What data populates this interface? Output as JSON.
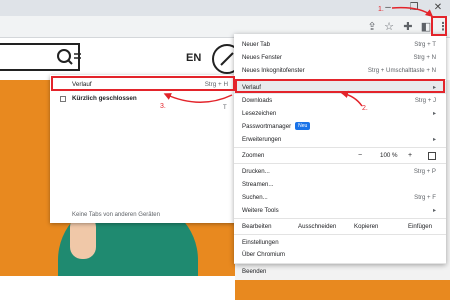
{
  "browser": {
    "window_controls": [
      "–",
      "❐",
      "✕"
    ]
  },
  "page": {
    "lang": "EN"
  },
  "submenu": {
    "items": [
      {
        "label": "Verlauf",
        "shortcut": "Strg + H"
      },
      {
        "label": "Kürzlich geschlossen",
        "shortcut": ""
      }
    ],
    "trailing_letter": "T",
    "footer": "Keine Tabs von anderen Geräten"
  },
  "menu": {
    "items": {
      "new_tab": {
        "label": "Neuer Tab",
        "shortcut": "Strg + T"
      },
      "new_window": {
        "label": "Neues Fenster",
        "shortcut": "Strg + N"
      },
      "new_incognito": {
        "label": "Neues Inkognitofenster",
        "shortcut": "Strg + Umschalttaste + N"
      },
      "history": {
        "label": "Verlauf"
      },
      "downloads": {
        "label": "Downloads",
        "shortcut": "Strg + J"
      },
      "bookmarks": {
        "label": "Lesezeichen"
      },
      "password_manager": {
        "label": "Passwortmanager",
        "badge": "Neu"
      },
      "extensions": {
        "label": "Erweiterungen"
      },
      "zoom": {
        "label": "Zoomen",
        "minus": "−",
        "value": "100 %",
        "plus": "+"
      },
      "print": {
        "label": "Drucken...",
        "shortcut": "Strg + P"
      },
      "cast": {
        "label": "Streamen..."
      },
      "find": {
        "label": "Suchen...",
        "shortcut": "Strg + F"
      },
      "more_tools": {
        "label": "Weitere Tools"
      },
      "edit": {
        "label": "Bearbeiten",
        "cut": "Ausschneiden",
        "copy": "Kopieren",
        "paste": "Einfügen"
      },
      "settings": {
        "label": "Einstellungen"
      },
      "about": {
        "label": "Über Chromium"
      },
      "exit": {
        "label": "Beenden"
      }
    }
  },
  "annotations": {
    "step1": "1.",
    "step2": "2.",
    "step3": "3.",
    "color": "#e3242b"
  }
}
